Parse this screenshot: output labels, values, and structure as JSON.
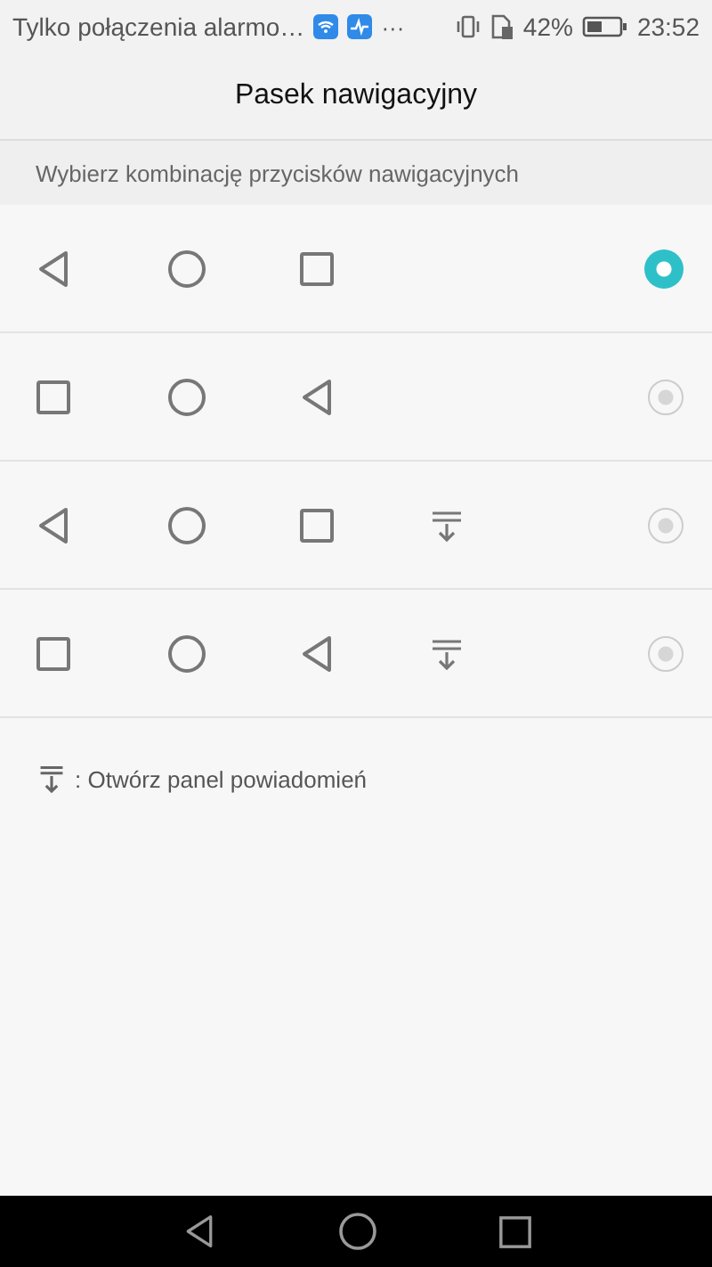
{
  "status_bar": {
    "notification": "Tylko połączenia alarmo…",
    "more": "···",
    "battery_percent": "42%",
    "time": "23:52"
  },
  "title": "Pasek nawigacyjny",
  "section_header": "Wybierz kombinację przycisków nawigacyjnych",
  "options": [
    {
      "buttons": [
        {
          "kind": "back"
        },
        {
          "kind": "home"
        },
        {
          "kind": "recent"
        }
      ],
      "selected": true
    },
    {
      "buttons": [
        {
          "kind": "recent"
        },
        {
          "kind": "home"
        },
        {
          "kind": "back"
        }
      ],
      "selected": false
    },
    {
      "buttons": [
        {
          "kind": "back"
        },
        {
          "kind": "home"
        },
        {
          "kind": "recent"
        },
        {
          "kind": "notify"
        }
      ],
      "selected": false
    },
    {
      "buttons": [
        {
          "kind": "recent"
        },
        {
          "kind": "home"
        },
        {
          "kind": "back"
        },
        {
          "kind": "notify"
        }
      ],
      "selected": false
    }
  ],
  "legend": ": Otwórz panel powiadomień",
  "nav_bar": [
    {
      "kind": "back"
    },
    {
      "kind": "home"
    },
    {
      "kind": "recent"
    }
  ]
}
